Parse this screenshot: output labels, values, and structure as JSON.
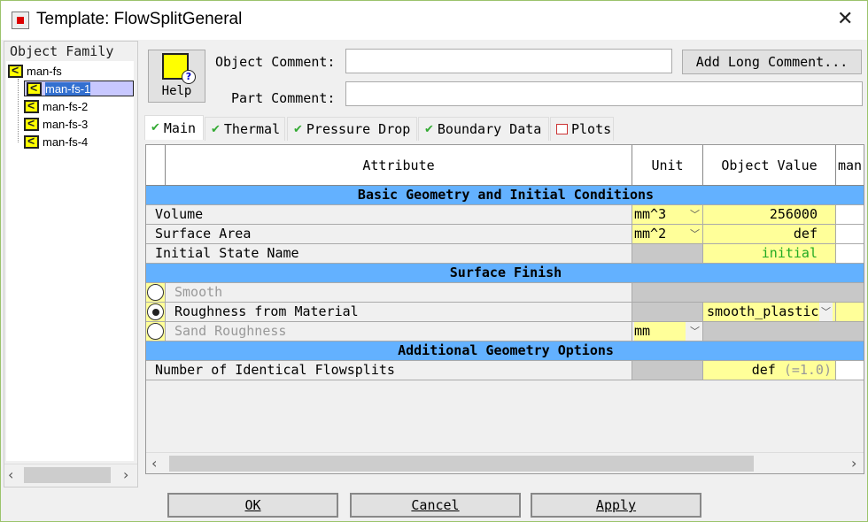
{
  "window": {
    "title": "Template: FlowSplitGeneral",
    "close": "✕"
  },
  "tree": {
    "label": "Object Family",
    "root": "man-fs",
    "children": [
      "man-fs-1",
      "man-fs-2",
      "man-fs-3",
      "man-fs-4"
    ],
    "selected": "man-fs-1"
  },
  "header": {
    "help": "Help",
    "object_comment_label": "Object Comment:",
    "object_comment": "",
    "part_comment_label": "Part Comment:",
    "part_comment": "",
    "add_long_comment": "Add Long Comment..."
  },
  "tabs": [
    {
      "label": "Main",
      "icon": "check-icon"
    },
    {
      "label": "Thermal",
      "icon": "check-icon"
    },
    {
      "label": "Pressure Drop",
      "icon": "check-icon"
    },
    {
      "label": "Boundary Data",
      "icon": "check-icon"
    },
    {
      "label": "Plots",
      "icon": "plot-icon"
    }
  ],
  "table": {
    "columns": [
      "Attribute",
      "Unit",
      "Object Value",
      "man"
    ],
    "sections": [
      "Basic Geometry and Initial Conditions",
      "Surface Finish",
      "Additional Geometry Options"
    ],
    "rows": {
      "volume": {
        "attr": "Volume",
        "unit": "mm^3",
        "value": "256000"
      },
      "area": {
        "attr": "Surface Area",
        "unit": "mm^2",
        "value": "def"
      },
      "state": {
        "attr": "Initial State Name",
        "value": "initial"
      },
      "smooth": {
        "attr": "Smooth"
      },
      "roughmat": {
        "attr": "Roughness from Material",
        "value": "smooth_plastic"
      },
      "sand": {
        "attr": "Sand Roughness",
        "unit": "mm"
      },
      "nflow": {
        "attr": "Number of Identical Flowsplits",
        "value": "def",
        "hint": "(=1.0)"
      }
    }
  },
  "buttons": {
    "ok": "OK",
    "cancel": "Cancel",
    "apply": "Apply"
  },
  "colors": {
    "section": "#63b1ff",
    "editable": "#ffff99",
    "disabled": "#c8c8c8"
  }
}
